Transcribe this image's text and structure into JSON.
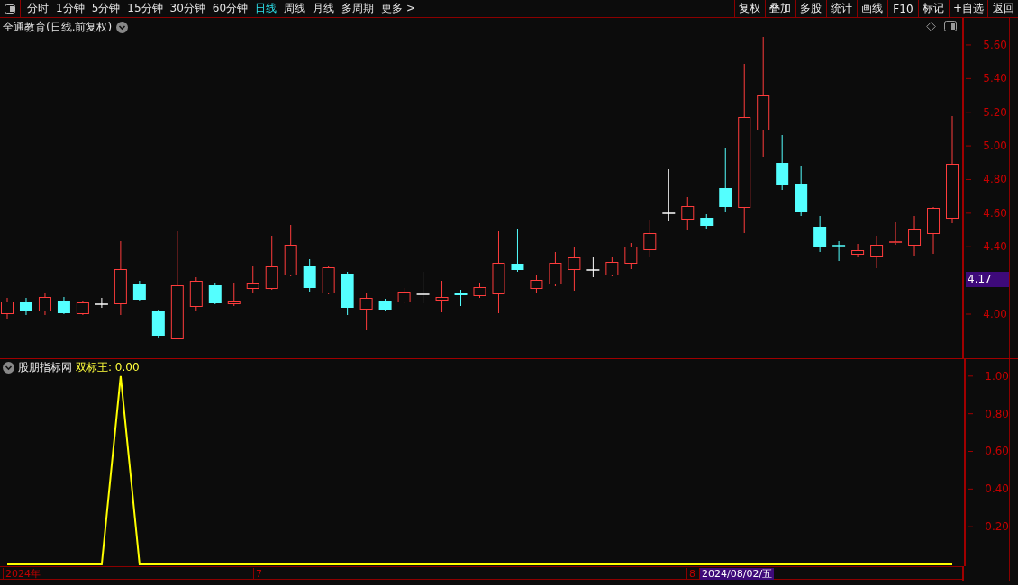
{
  "toolbar": {
    "periods": [
      {
        "label": "分时",
        "selected": false
      },
      {
        "label": "1分钟",
        "selected": false
      },
      {
        "label": "5分钟",
        "selected": false
      },
      {
        "label": "15分钟",
        "selected": false
      },
      {
        "label": "30分钟",
        "selected": false
      },
      {
        "label": "60分钟",
        "selected": false
      },
      {
        "label": "日线",
        "selected": true
      },
      {
        "label": "周线",
        "selected": false
      },
      {
        "label": "月线",
        "selected": false
      },
      {
        "label": "多周期",
        "selected": false
      },
      {
        "label": "更多 >",
        "selected": false
      }
    ],
    "buttons": [
      "复权",
      "叠加",
      "多股",
      "统计",
      "画线",
      "F10",
      "标记",
      "+自选",
      "返回"
    ]
  },
  "main_chart": {
    "title": "全通教育(日线.前复权)",
    "price_ticks": [
      "5.60",
      "5.40",
      "5.20",
      "5.00",
      "4.80",
      "4.60",
      "4.40",
      "4.00"
    ],
    "last_price": "4.17"
  },
  "indicator": {
    "name": "股朋指标网",
    "reading": "双标王: 0.00",
    "chart_data": {
      "type": "line",
      "series": [
        {
          "color": "#ffff00",
          "values": [
            0,
            0,
            0,
            0,
            0,
            0,
            1,
            0,
            0,
            0,
            0,
            0,
            0,
            0,
            0,
            0,
            0,
            0,
            0,
            0,
            0,
            0,
            0,
            0,
            0,
            0,
            0,
            0,
            0,
            0,
            0,
            0,
            0,
            0,
            0,
            0,
            0,
            0,
            0,
            0,
            0,
            0,
            0,
            0,
            0,
            0,
            0,
            0,
            0,
            0,
            0
          ]
        }
      ],
      "ylim": [
        0,
        1.09
      ],
      "yticks": [
        {
          "value": 1.0,
          "label": "1.00"
        },
        {
          "value": 0.8,
          "label": "0.80"
        },
        {
          "value": 0.6,
          "label": "0.60"
        },
        {
          "value": 0.4,
          "label": "0.40"
        },
        {
          "value": 0.2,
          "label": "0.20"
        }
      ]
    }
  },
  "time_axis": [
    {
      "kind": "year",
      "label": "2024年"
    },
    {
      "kind": "month",
      "label": "7"
    },
    {
      "kind": "month",
      "label": "8"
    },
    {
      "kind": "cursor",
      "label": "2024/08/02/五"
    }
  ]
}
